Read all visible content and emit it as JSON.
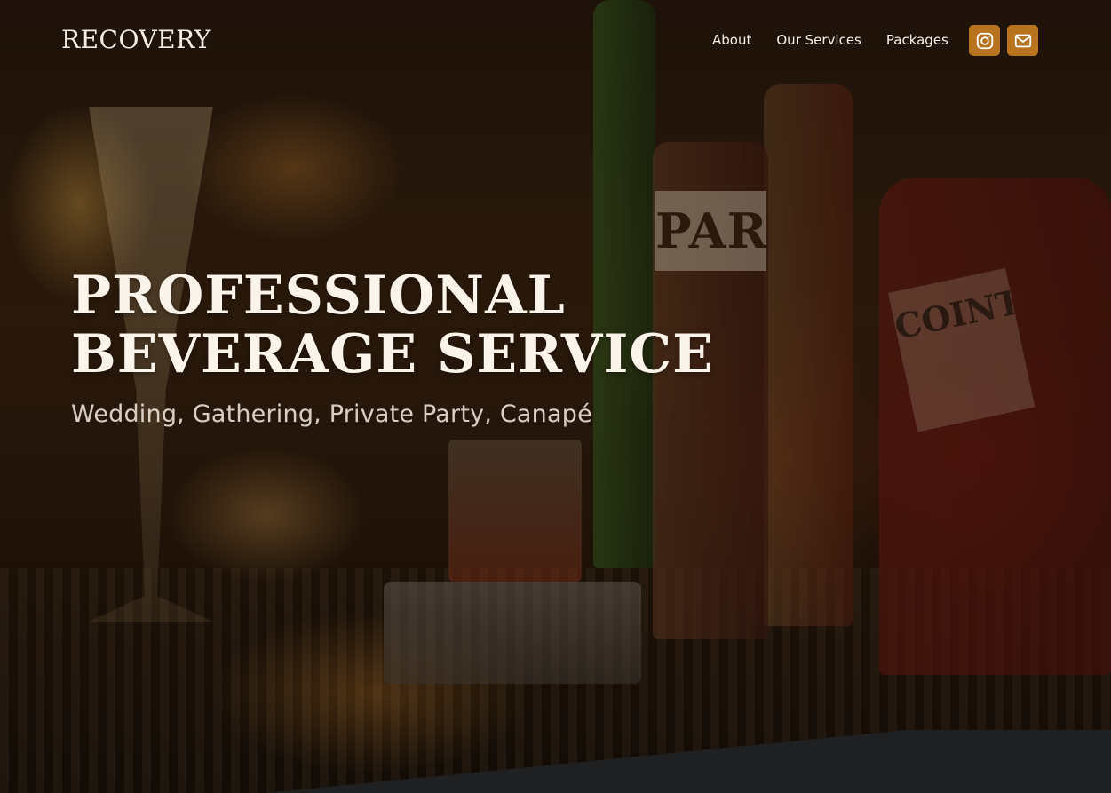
{
  "brand": {
    "logo_text": "RECOVERY"
  },
  "nav": {
    "links": [
      {
        "label": "About"
      },
      {
        "label": "Our Services"
      },
      {
        "label": "Packages"
      }
    ],
    "social": [
      {
        "icon": "instagram-icon",
        "color": "#b8731f"
      },
      {
        "icon": "mail-icon",
        "color": "#b8731f"
      }
    ]
  },
  "hero": {
    "headline_line1": "PROFESSIONAL",
    "headline_line2": "BEVERAGE SERVICE",
    "subheadline": "Wedding, Gathering, Private Party, Canapé",
    "background_image_text": {
      "bottle_label_1": "PARI",
      "bottle_label_2": "COINTREAU"
    }
  },
  "colors": {
    "accent": "#b8731f",
    "text_light": "#fbf4ea",
    "footer_band": "#1f2021"
  }
}
